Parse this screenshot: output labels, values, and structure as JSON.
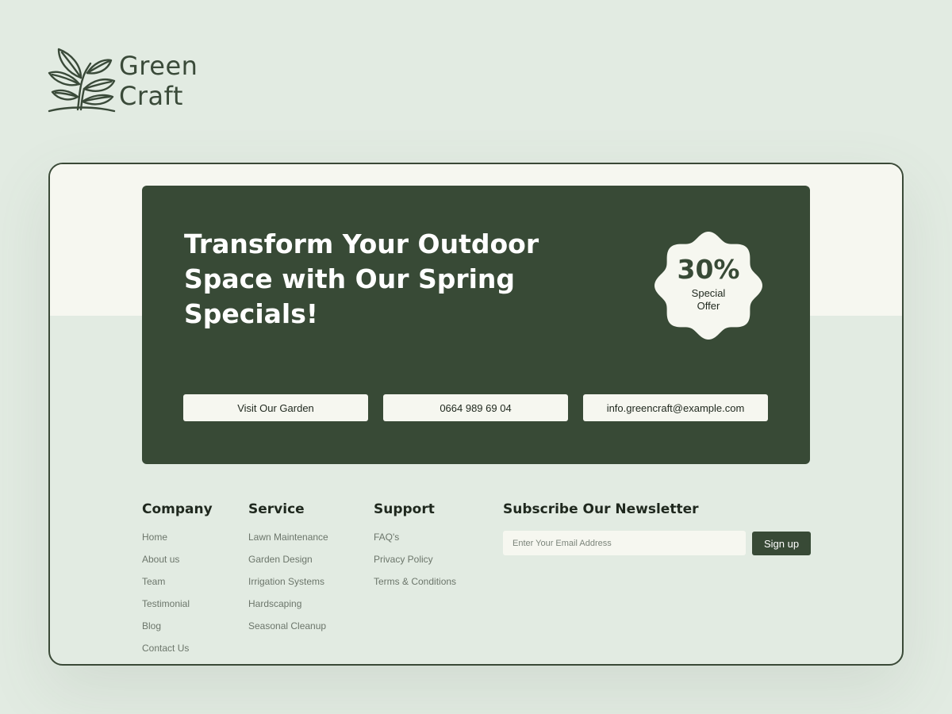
{
  "brand": {
    "name_line1": "Green",
    "name_line2": "Craft",
    "logo_icon": "plant-sprout-icon"
  },
  "hero": {
    "title": "Transform Your Outdoor Space with Our Spring Specials!",
    "badge": {
      "percent": "30%",
      "label_line1": "Special",
      "label_line2": "Offer"
    },
    "buttons": {
      "visit": "Visit Our Garden",
      "phone": "0664 989 69 04",
      "email": "info.greencraft@example.com"
    }
  },
  "footer": {
    "company": {
      "title": "Company",
      "links": [
        "Home",
        "About us",
        "Team",
        "Testimonial",
        "Blog",
        "Contact Us"
      ]
    },
    "service": {
      "title": "Service",
      "links": [
        "Lawn Maintenance",
        "Garden Design",
        "Irrigation Systems",
        "Hardscaping",
        "Seasonal Cleanup"
      ]
    },
    "support": {
      "title": "Support",
      "links": [
        "FAQ's",
        "Privacy Policy",
        "Terms & Conditions"
      ]
    },
    "newsletter": {
      "title": "Subscribe Our Newsletter",
      "placeholder": "Enter Your Email Address",
      "value": "",
      "button": "Sign up"
    }
  },
  "colors": {
    "page_bg": "#e2ebe2",
    "frame_top_bg": "#f6f7f0",
    "hero_bg": "#384a36",
    "accent_dark": "#3a4937",
    "button_bg": "#f6f7f0",
    "link_text": "#6c766b"
  }
}
